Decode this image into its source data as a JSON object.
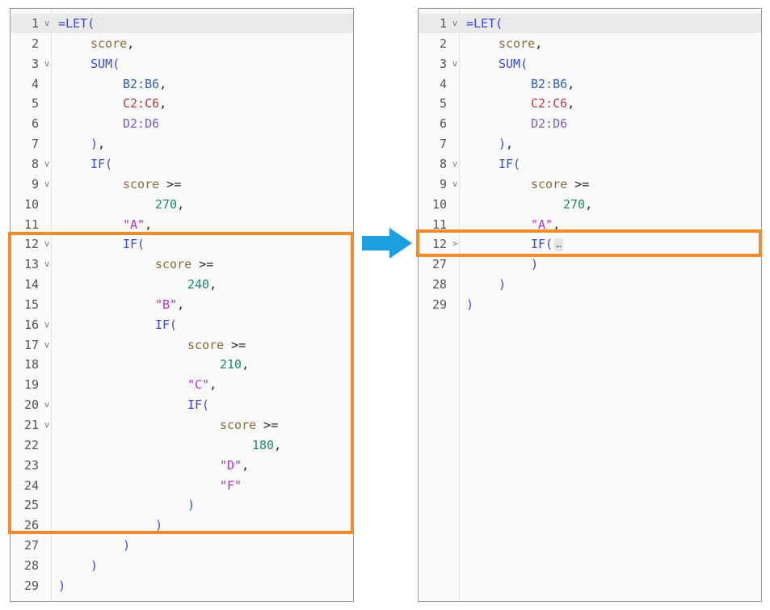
{
  "colors": {
    "highlight": "#f58a2b",
    "arrow": "#1aa0e0",
    "function": "#3b48d6",
    "variable": "#8a6a3a",
    "number": "#1a8a66",
    "string": "#b232c6"
  },
  "left_editor": {
    "lines": [
      {
        "n": "1",
        "fold": "v",
        "indent": 0,
        "tokens": [
          {
            "t": "=LET(",
            "c": "fn"
          }
        ]
      },
      {
        "n": "2",
        "fold": "",
        "indent": 1,
        "tokens": [
          {
            "t": "score",
            "c": "var"
          },
          {
            "t": ",",
            "c": "op"
          }
        ]
      },
      {
        "n": "3",
        "fold": "v",
        "indent": 1,
        "tokens": [
          {
            "t": "SUM(",
            "c": "fn"
          }
        ]
      },
      {
        "n": "4",
        "fold": "",
        "indent": 2,
        "tokens": [
          {
            "t": "B2:B6",
            "c": "ref1"
          },
          {
            "t": ",",
            "c": "op"
          }
        ]
      },
      {
        "n": "5",
        "fold": "",
        "indent": 2,
        "tokens": [
          {
            "t": "C2:C6",
            "c": "ref2"
          },
          {
            "t": ",",
            "c": "op"
          }
        ]
      },
      {
        "n": "6",
        "fold": "",
        "indent": 2,
        "tokens": [
          {
            "t": "D2:D6",
            "c": "ref3"
          }
        ]
      },
      {
        "n": "7",
        "fold": "",
        "indent": 1,
        "tokens": [
          {
            "t": ")",
            "c": "fn"
          },
          {
            "t": ",",
            "c": "op"
          }
        ]
      },
      {
        "n": "8",
        "fold": "v",
        "indent": 1,
        "tokens": [
          {
            "t": "IF(",
            "c": "fn"
          }
        ]
      },
      {
        "n": "9",
        "fold": "v",
        "indent": 2,
        "tokens": [
          {
            "t": "score",
            "c": "var"
          },
          {
            "t": " >=",
            "c": "op"
          }
        ]
      },
      {
        "n": "10",
        "fold": "",
        "indent": 3,
        "tokens": [
          {
            "t": "270",
            "c": "num"
          },
          {
            "t": ",",
            "c": "op"
          }
        ]
      },
      {
        "n": "11",
        "fold": "",
        "indent": 2,
        "tokens": [
          {
            "t": "\"A\"",
            "c": "str"
          },
          {
            "t": ",",
            "c": "op"
          }
        ]
      },
      {
        "n": "12",
        "fold": "v",
        "indent": 2,
        "tokens": [
          {
            "t": "IF(",
            "c": "fn"
          }
        ]
      },
      {
        "n": "13",
        "fold": "v",
        "indent": 3,
        "tokens": [
          {
            "t": "score",
            "c": "var"
          },
          {
            "t": " >=",
            "c": "op"
          }
        ]
      },
      {
        "n": "14",
        "fold": "",
        "indent": 4,
        "tokens": [
          {
            "t": "240",
            "c": "num"
          },
          {
            "t": ",",
            "c": "op"
          }
        ]
      },
      {
        "n": "15",
        "fold": "",
        "indent": 3,
        "tokens": [
          {
            "t": "\"B\"",
            "c": "str"
          },
          {
            "t": ",",
            "c": "op"
          }
        ]
      },
      {
        "n": "16",
        "fold": "v",
        "indent": 3,
        "tokens": [
          {
            "t": "IF(",
            "c": "fn"
          }
        ]
      },
      {
        "n": "17",
        "fold": "v",
        "indent": 4,
        "tokens": [
          {
            "t": "score",
            "c": "var"
          },
          {
            "t": " >=",
            "c": "op"
          }
        ]
      },
      {
        "n": "18",
        "fold": "",
        "indent": 5,
        "tokens": [
          {
            "t": "210",
            "c": "num"
          },
          {
            "t": ",",
            "c": "op"
          }
        ]
      },
      {
        "n": "19",
        "fold": "",
        "indent": 4,
        "tokens": [
          {
            "t": "\"C\"",
            "c": "str"
          },
          {
            "t": ",",
            "c": "op"
          }
        ]
      },
      {
        "n": "20",
        "fold": "v",
        "indent": 4,
        "tokens": [
          {
            "t": "IF(",
            "c": "fn"
          }
        ]
      },
      {
        "n": "21",
        "fold": "v",
        "indent": 5,
        "tokens": [
          {
            "t": "score",
            "c": "var"
          },
          {
            "t": " >=",
            "c": "op"
          }
        ]
      },
      {
        "n": "22",
        "fold": "",
        "indent": 6,
        "tokens": [
          {
            "t": "180",
            "c": "num"
          },
          {
            "t": ",",
            "c": "op"
          }
        ]
      },
      {
        "n": "23",
        "fold": "",
        "indent": 5,
        "tokens": [
          {
            "t": "\"D\"",
            "c": "str"
          },
          {
            "t": ",",
            "c": "op"
          }
        ]
      },
      {
        "n": "24",
        "fold": "",
        "indent": 5,
        "tokens": [
          {
            "t": "\"F\"",
            "c": "str"
          }
        ]
      },
      {
        "n": "25",
        "fold": "",
        "indent": 4,
        "tokens": [
          {
            "t": ")",
            "c": "fn"
          }
        ]
      },
      {
        "n": "26",
        "fold": "",
        "indent": 3,
        "tokens": [
          {
            "t": ")",
            "c": "fn"
          }
        ]
      },
      {
        "n": "27",
        "fold": "",
        "indent": 2,
        "tokens": [
          {
            "t": ")",
            "c": "fn"
          }
        ]
      },
      {
        "n": "28",
        "fold": "",
        "indent": 1,
        "tokens": [
          {
            "t": ")",
            "c": "fn"
          }
        ]
      },
      {
        "n": "29",
        "fold": "",
        "indent": 0,
        "tokens": [
          {
            "t": ")",
            "c": "fn"
          }
        ]
      }
    ]
  },
  "right_editor": {
    "lines": [
      {
        "n": "1",
        "fold": "v",
        "indent": 0,
        "tokens": [
          {
            "t": "=LET(",
            "c": "fn"
          }
        ]
      },
      {
        "n": "2",
        "fold": "",
        "indent": 1,
        "tokens": [
          {
            "t": "score",
            "c": "var"
          },
          {
            "t": ",",
            "c": "op"
          }
        ]
      },
      {
        "n": "3",
        "fold": "v",
        "indent": 1,
        "tokens": [
          {
            "t": "SUM(",
            "c": "fn"
          }
        ]
      },
      {
        "n": "4",
        "fold": "",
        "indent": 2,
        "tokens": [
          {
            "t": "B2:B6",
            "c": "ref1"
          },
          {
            "t": ",",
            "c": "op"
          }
        ]
      },
      {
        "n": "5",
        "fold": "",
        "indent": 2,
        "tokens": [
          {
            "t": "C2:C6",
            "c": "ref2"
          },
          {
            "t": ",",
            "c": "op"
          }
        ]
      },
      {
        "n": "6",
        "fold": "",
        "indent": 2,
        "tokens": [
          {
            "t": "D2:D6",
            "c": "ref3"
          }
        ]
      },
      {
        "n": "7",
        "fold": "",
        "indent": 1,
        "tokens": [
          {
            "t": ")",
            "c": "fn"
          },
          {
            "t": ",",
            "c": "op"
          }
        ]
      },
      {
        "n": "8",
        "fold": "v",
        "indent": 1,
        "tokens": [
          {
            "t": "IF(",
            "c": "fn"
          }
        ]
      },
      {
        "n": "9",
        "fold": "v",
        "indent": 2,
        "tokens": [
          {
            "t": "score",
            "c": "var"
          },
          {
            "t": " >=",
            "c": "op"
          }
        ]
      },
      {
        "n": "10",
        "fold": "",
        "indent": 3,
        "tokens": [
          {
            "t": "270",
            "c": "num"
          },
          {
            "t": ",",
            "c": "op"
          }
        ]
      },
      {
        "n": "11",
        "fold": "",
        "indent": 2,
        "tokens": [
          {
            "t": "\"A\"",
            "c": "str"
          },
          {
            "t": ",",
            "c": "op"
          }
        ]
      },
      {
        "n": "12",
        "fold": ">",
        "indent": 2,
        "tokens": [
          {
            "t": "IF(",
            "c": "fn"
          }
        ],
        "collapsed": true,
        "collapsed_marker": "…"
      },
      {
        "n": "27",
        "fold": "",
        "indent": 2,
        "tokens": [
          {
            "t": ")",
            "c": "fn"
          }
        ]
      },
      {
        "n": "28",
        "fold": "",
        "indent": 1,
        "tokens": [
          {
            "t": ")",
            "c": "fn"
          }
        ]
      },
      {
        "n": "29",
        "fold": "",
        "indent": 0,
        "tokens": [
          {
            "t": ")",
            "c": "fn"
          }
        ]
      }
    ]
  }
}
